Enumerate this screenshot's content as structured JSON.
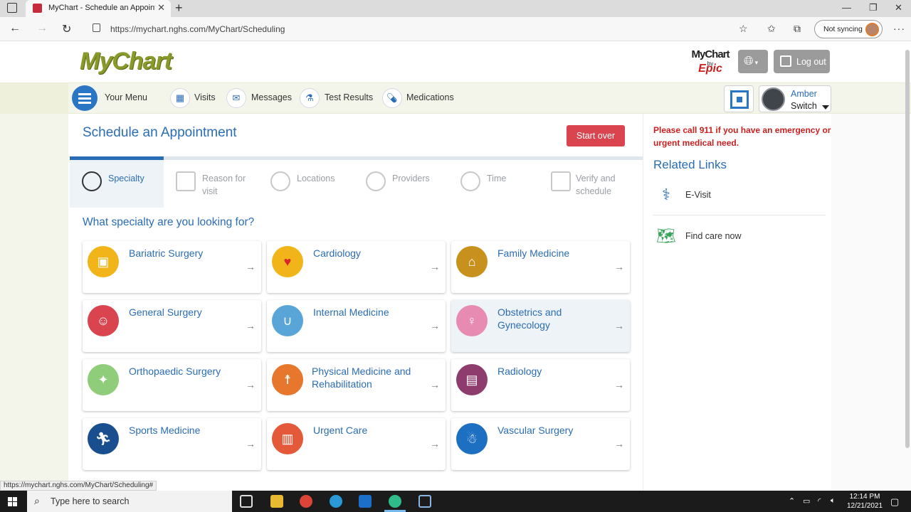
{
  "browser": {
    "tab_title": "MyChart - Schedule an Appointment",
    "tab_close": "✕",
    "new_tab": "+",
    "url": "https://mychart.nghs.com/MyChart/Scheduling",
    "sync_label": "Not syncing",
    "status_url": "https://mychart.nghs.com/MyChart/Scheduling#"
  },
  "header": {
    "logo": "MyChart",
    "epic_logo_top": "MyChart",
    "epic_logo_by": "by",
    "epic_logo_brand": "Epic",
    "logout_label": "Log out"
  },
  "menubar": {
    "your_menu": "Your Menu",
    "items": [
      {
        "label": "Visits",
        "icon": "calendar-icon"
      },
      {
        "label": "Messages",
        "icon": "envelope-icon"
      },
      {
        "label": "Test Results",
        "icon": "flask-icon"
      },
      {
        "label": "Medications",
        "icon": "pill-icon"
      }
    ],
    "user_name": "Amber",
    "user_switch": "Switch"
  },
  "main": {
    "title": "Schedule an Appointment",
    "start_over": "Start over",
    "steps": [
      {
        "label": "Specialty",
        "icon": "stethoscope-icon",
        "active": true
      },
      {
        "label": "Reason for visit",
        "icon": "clipboard-icon",
        "active": false
      },
      {
        "label": "Locations",
        "icon": "map-pin-icon",
        "active": false
      },
      {
        "label": "Providers",
        "icon": "person-icon",
        "active": false
      },
      {
        "label": "Time",
        "icon": "clock-icon",
        "active": false
      },
      {
        "label": "Verify and schedule",
        "icon": "calendar-check-icon",
        "active": false
      }
    ],
    "question": "What specialty are you looking for?",
    "specialties": [
      {
        "label": "Bariatric Surgery",
        "icon": "scale-icon",
        "color": "#f2b519"
      },
      {
        "label": "Cardiology",
        "icon": "heart-icon",
        "color": "#f2b519"
      },
      {
        "label": "Family Medicine",
        "icon": "family-home-icon",
        "color": "#c8901c"
      },
      {
        "label": "General Surgery",
        "icon": "surgeon-icon",
        "color": "#d9444f"
      },
      {
        "label": "Internal Medicine",
        "icon": "stethoscope-icon",
        "color": "#5aa5d8"
      },
      {
        "label": "Obstetrics and Gynecology",
        "icon": "pregnant-icon",
        "color": "#e88bb3"
      },
      {
        "label": "Orthopaedic Surgery",
        "icon": "knee-joint-icon",
        "color": "#8fcd7a"
      },
      {
        "label": "Physical Medicine and Rehabilitation",
        "icon": "stretch-icon",
        "color": "#e8772e"
      },
      {
        "label": "Radiology",
        "icon": "xray-icon",
        "color": "#8e3b6e"
      },
      {
        "label": "Sports Medicine",
        "icon": "runner-icon",
        "color": "#1a4f8f"
      },
      {
        "label": "Urgent Care",
        "icon": "hospital-icon",
        "color": "#e4593a"
      },
      {
        "label": "Vascular Surgery",
        "icon": "body-icon",
        "color": "#1d6fc2"
      }
    ],
    "hovered_specialty": "Obstetrics and Gynecology"
  },
  "sidebar": {
    "emergency": "Please call 911 if you have an emergency or urgent medical need.",
    "related_title": "Related Links",
    "links": [
      {
        "label": "E-Visit",
        "icon": "stethoscope-icon"
      },
      {
        "label": "Find care now",
        "icon": "map-icon"
      }
    ]
  },
  "taskbar": {
    "search_placeholder": "Type here to search",
    "time": "12:14 PM",
    "date": "12/21/2021"
  },
  "colors": {
    "primary_blue": "#2a6db5",
    "logo_green": "#8a9a2a",
    "start_over_red": "#d9444f",
    "emergency_red": "#cc1f1f"
  }
}
